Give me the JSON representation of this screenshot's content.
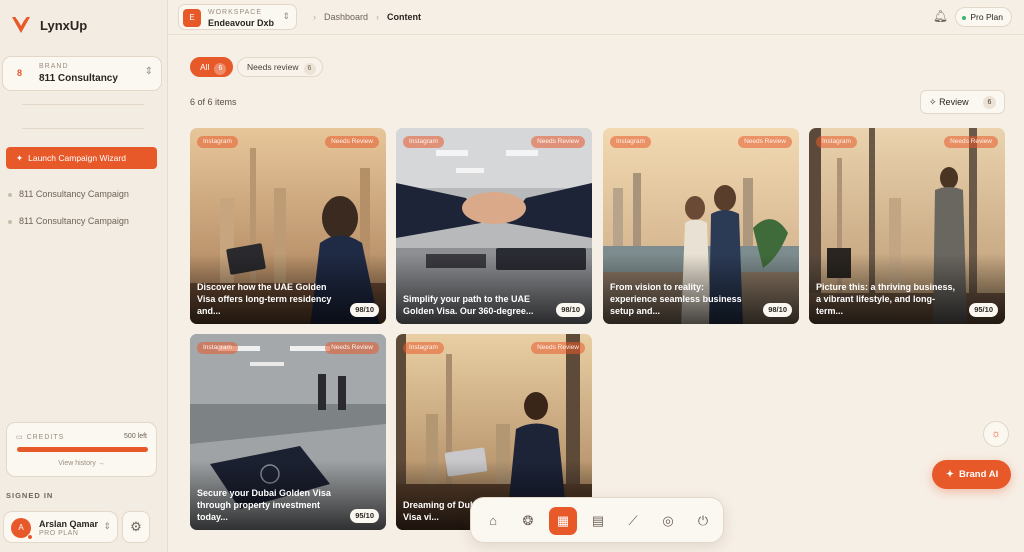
{
  "sidebar": {
    "logo": "LynxUp",
    "brand": {
      "number": "8",
      "label": "BRAND",
      "value": "811 Consultancy"
    },
    "launch_label": "Launch Campaign Wizard",
    "campaigns": [
      "811 Consultancy Campaign",
      "811 Consultancy Campaign"
    ],
    "credits": {
      "label": "CREDITS",
      "left": "500 left",
      "link": "View history →",
      "fill_percent": 100
    },
    "signed_in_label": "SIGNED IN",
    "user": {
      "initial": "A",
      "name": "Arslan Qamar",
      "plan": "PRO PLAN"
    }
  },
  "topbar": {
    "workspace": {
      "label": "WORKSPACE",
      "value": "Endeavour Dxb",
      "icon": "E"
    },
    "breadcrumb": [
      "Dashboard",
      "Content"
    ],
    "plan_badge": "Pro Plan"
  },
  "filters": [
    {
      "label": "All",
      "count": "6"
    },
    {
      "label": "Needs review",
      "count": "6"
    }
  ],
  "items_count": "6 of 6 items",
  "review": {
    "label": "Review",
    "count": "6"
  },
  "cards": [
    {
      "platform": "Instagram",
      "status": "Needs Review",
      "caption": "Discover how the UAE Golden Visa offers long-term residency and...",
      "score": "98/10"
    },
    {
      "platform": "Instagram",
      "status": "Needs Review",
      "caption": "Simplify your path to the UAE Golden Visa. Our 360-degree...",
      "score": "98/10"
    },
    {
      "platform": "Instagram",
      "status": "Needs Review",
      "caption": "From vision to reality: experience seamless business setup and...",
      "score": "98/10"
    },
    {
      "platform": "Instagram",
      "status": "Needs Review",
      "caption": "Picture this: a thriving business, a vibrant lifestyle, and long-term...",
      "score": "95/10"
    },
    {
      "platform": "Instagram",
      "status": "Needs Review",
      "caption": "Secure your Dubai Golden Visa through property investment today...",
      "score": "95/10"
    },
    {
      "platform": "Instagram",
      "status": "Needs Review",
      "caption": "Dreaming of Dubai? Your Golden Visa vi...",
      "score": ""
    }
  ],
  "dock": [
    "home-icon",
    "brain-icon",
    "grid-icon",
    "calendar-icon",
    "chart-icon",
    "target-icon",
    "plug-icon"
  ],
  "brand_ai_label": "Brand AI"
}
